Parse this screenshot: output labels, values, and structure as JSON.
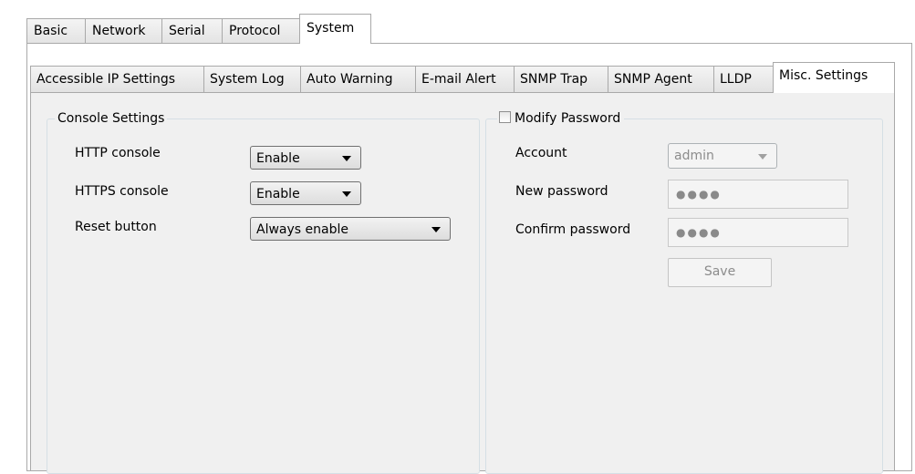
{
  "top_tabs": [
    {
      "label": "Basic"
    },
    {
      "label": "Network"
    },
    {
      "label": "Serial"
    },
    {
      "label": "Protocol"
    },
    {
      "label": "System",
      "active": true
    }
  ],
  "sub_tabs": [
    {
      "label": "Accessible IP Settings"
    },
    {
      "label": "System Log"
    },
    {
      "label": "Auto Warning"
    },
    {
      "label": "E-mail Alert"
    },
    {
      "label": "SNMP Trap"
    },
    {
      "label": "SNMP Agent"
    },
    {
      "label": "LLDP"
    },
    {
      "label": "Misc. Settings",
      "active": true
    }
  ],
  "console": {
    "title": "Console Settings",
    "http_label": "HTTP console",
    "http_value": "Enable",
    "https_label": "HTTPS console",
    "https_value": "Enable",
    "reset_label": "Reset button",
    "reset_value": "Always enable"
  },
  "password": {
    "title": "Modify Password",
    "checked": false,
    "account_label": "Account",
    "account_value": "admin",
    "new_label": "New password",
    "new_value": "●●●●",
    "confirm_label": "Confirm password",
    "confirm_value": "●●●●",
    "save_label": "Save"
  }
}
